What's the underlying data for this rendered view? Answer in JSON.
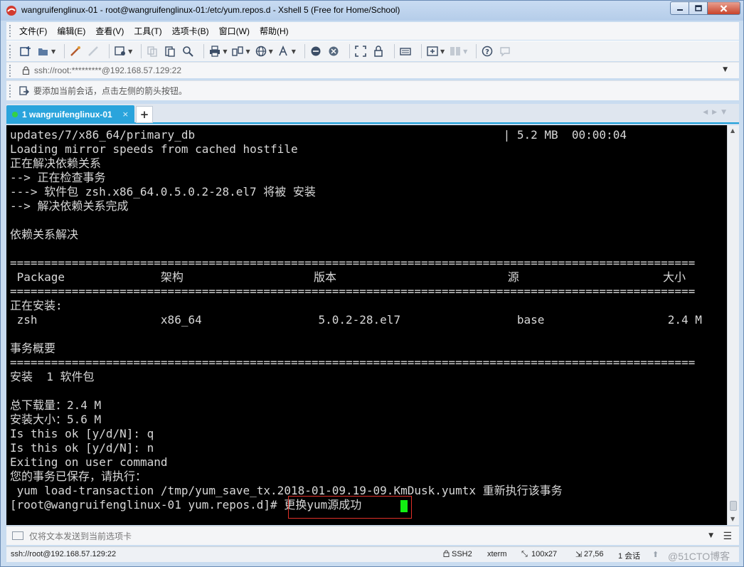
{
  "window": {
    "title": "wangruifenglinux-01 - root@wangruifenglinux-01:/etc/yum.repos.d - Xshell 5 (Free for Home/School)",
    "minimize_icon": "minimize-icon",
    "maximize_icon": "maximize-icon",
    "close_icon": "close-icon"
  },
  "menu": [
    "文件(F)",
    "编辑(E)",
    "查看(V)",
    "工具(T)",
    "选项卡(B)",
    "窗口(W)",
    "帮助(H)"
  ],
  "address": {
    "value": "ssh://root:*********@192.168.57.129:22"
  },
  "hint": {
    "text": "要添加当前会话，点击左侧的箭头按钮。"
  },
  "tab": {
    "label": "1 wangruifenglinux-01",
    "close": "×",
    "add": "+"
  },
  "terminal": {
    "lines": [
      "updates/7/x86_64/primary_db                                             | 5.2 MB  00:00:04",
      "Loading mirror speeds from cached hostfile",
      "正在解决依赖关系",
      "--> 正在检查事务",
      "---> 软件包 zsh.x86_64.0.5.0.2-28.el7 将被 安装",
      "--> 解决依赖关系完成",
      "",
      "依赖关系解决",
      "",
      "====================================================================================================",
      " Package              架构                   版本                         源                     大小",
      "====================================================================================================",
      "正在安装:",
      " zsh                  x86_64                 5.0.2-28.el7                 base                  2.4 M",
      "",
      "事务概要",
      "====================================================================================================",
      "安装  1 软件包",
      "",
      "总下载量：2.4 M",
      "安装大小：5.6 M",
      "Is this ok [y/d/N]: q",
      "Is this ok [y/d/N]: n",
      "Exiting on user command",
      "您的事务已保存，请执行：",
      " yum load-transaction /tmp/yum_save_tx.2018-01-09.19-09.KmDusk.yumtx 重新执行该事务",
      "[root@wangruifenglinux-01 yum.repos.d]# 更换yum源成功 "
    ]
  },
  "compose": {
    "placeholder": "仅将文本发送到当前选项卡"
  },
  "status": {
    "connection": "ssh://root@192.168.57.129:22",
    "protocol": "SSH2",
    "terminal_type": "xterm",
    "size": "100x27",
    "cursor_pos": "27,56",
    "sessions": "1 会话",
    "watermark": "@51CTO博客"
  }
}
